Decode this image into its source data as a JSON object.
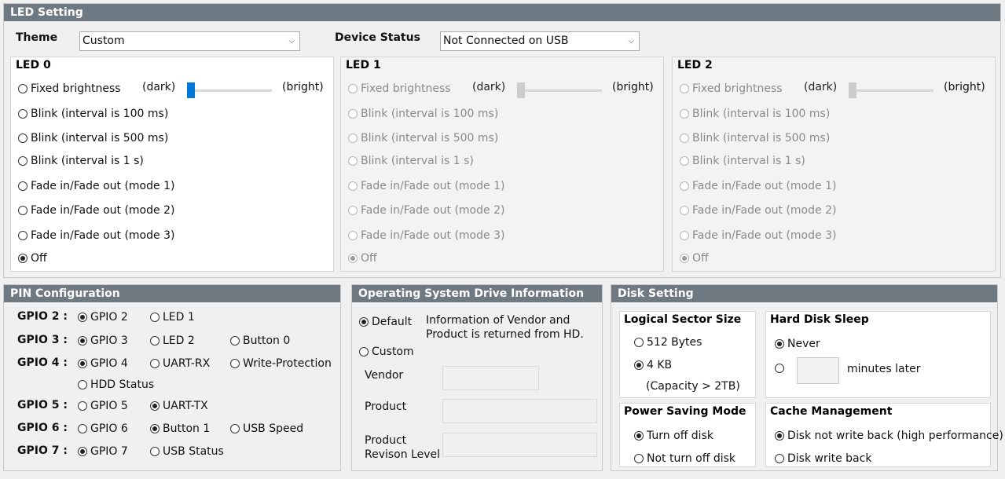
{
  "led_setting": {
    "title": "LED Setting",
    "theme_label": "Theme",
    "theme_value": "Custom",
    "device_status_label": "Device Status",
    "device_status_value": "Not Connected on USB",
    "leds": [
      {
        "name": "LED 0",
        "enabled": true,
        "options": [
          "Fixed brightness",
          "Blink (interval is 100 ms)",
          "Blink (interval is 500 ms)",
          "Blink (interval is 1 s)",
          "Fade in/Fade out (mode 1)",
          "Fade in/Fade out (mode 2)",
          "Fade in/Fade out (mode 3)",
          "Off"
        ],
        "selected": "Off",
        "dark_label": "(dark)",
        "bright_label": "(bright)",
        "brightness": 0.0
      },
      {
        "name": "LED 1",
        "enabled": false,
        "options": [
          "Fixed brightness",
          "Blink (interval is 100 ms)",
          "Blink (interval is 500 ms)",
          "Blink (interval is 1 s)",
          "Fade in/Fade out (mode 1)",
          "Fade in/Fade out (mode 2)",
          "Fade in/Fade out (mode 3)",
          "Off"
        ],
        "selected": "Off",
        "dark_label": "(dark)",
        "bright_label": "(bright)",
        "brightness": 0.0
      },
      {
        "name": "LED 2",
        "enabled": false,
        "options": [
          "Fixed brightness",
          "Blink (interval is 100 ms)",
          "Blink (interval is 500 ms)",
          "Blink (interval is 1 s)",
          "Fade in/Fade out (mode 1)",
          "Fade in/Fade out (mode 2)",
          "Fade in/Fade out (mode 3)",
          "Off"
        ],
        "selected": "Off",
        "dark_label": "(dark)",
        "bright_label": "(bright)",
        "brightness": 0.0
      }
    ]
  },
  "pin_config": {
    "title": "PIN Configuration",
    "rows": [
      {
        "label": "GPIO 2 :",
        "options": [
          "GPIO 2",
          "LED 1"
        ],
        "selected": "GPIO 2"
      },
      {
        "label": "GPIO 3 :",
        "options": [
          "GPIO 3",
          "LED 2",
          "Button 0"
        ],
        "selected": "GPIO 3"
      },
      {
        "label": "GPIO 4 :",
        "options": [
          "GPIO 4",
          "UART-RX",
          "Write-Protection",
          "HDD Status"
        ],
        "selected": "GPIO 4"
      },
      {
        "label": "GPIO 5 :",
        "options": [
          "GPIO 5",
          "UART-TX"
        ],
        "selected": "UART-TX"
      },
      {
        "label": "GPIO 6 :",
        "options": [
          "GPIO 6",
          "Button 1",
          "USB Speed"
        ],
        "selected": "Button 1"
      },
      {
        "label": "GPIO 7 :",
        "options": [
          "GPIO 7",
          "USB Status"
        ],
        "selected": "GPIO 7"
      }
    ]
  },
  "os_drive": {
    "title": "Operating System Drive Information",
    "default_label": "Default",
    "default_desc_line1": "Information of Vendor and",
    "default_desc_line2": "Product is returned from HD.",
    "custom_label": "Custom",
    "selected": "Default",
    "vendor_label": "Vendor",
    "product_label": "Product",
    "revision_label_line1": "Product",
    "revision_label_line2": "Revison Level",
    "vendor_value": "",
    "product_value": "",
    "revision_value": ""
  },
  "disk_setting": {
    "title": "Disk Setting",
    "sector": {
      "title": "Logical Sector Size",
      "options": [
        "512 Bytes",
        "4 KB"
      ],
      "selected": "4 KB",
      "note": "(Capacity > 2TB)"
    },
    "sleep": {
      "title": "Hard Disk Sleep",
      "never_label": "Never",
      "minutes_label": "minutes later",
      "selected": "Never",
      "minutes_value": ""
    },
    "power": {
      "title": "Power Saving Mode",
      "options": [
        "Turn off disk",
        "Not turn off disk"
      ],
      "selected": "Turn off disk"
    },
    "cache": {
      "title": "Cache Management",
      "options": [
        "Disk not write back (high performance)",
        "Disk write back"
      ],
      "selected": "Disk not write back (high performance)"
    }
  },
  "colors": {
    "header_bg": "#6f7981",
    "slider_accent": "#0078d7"
  }
}
